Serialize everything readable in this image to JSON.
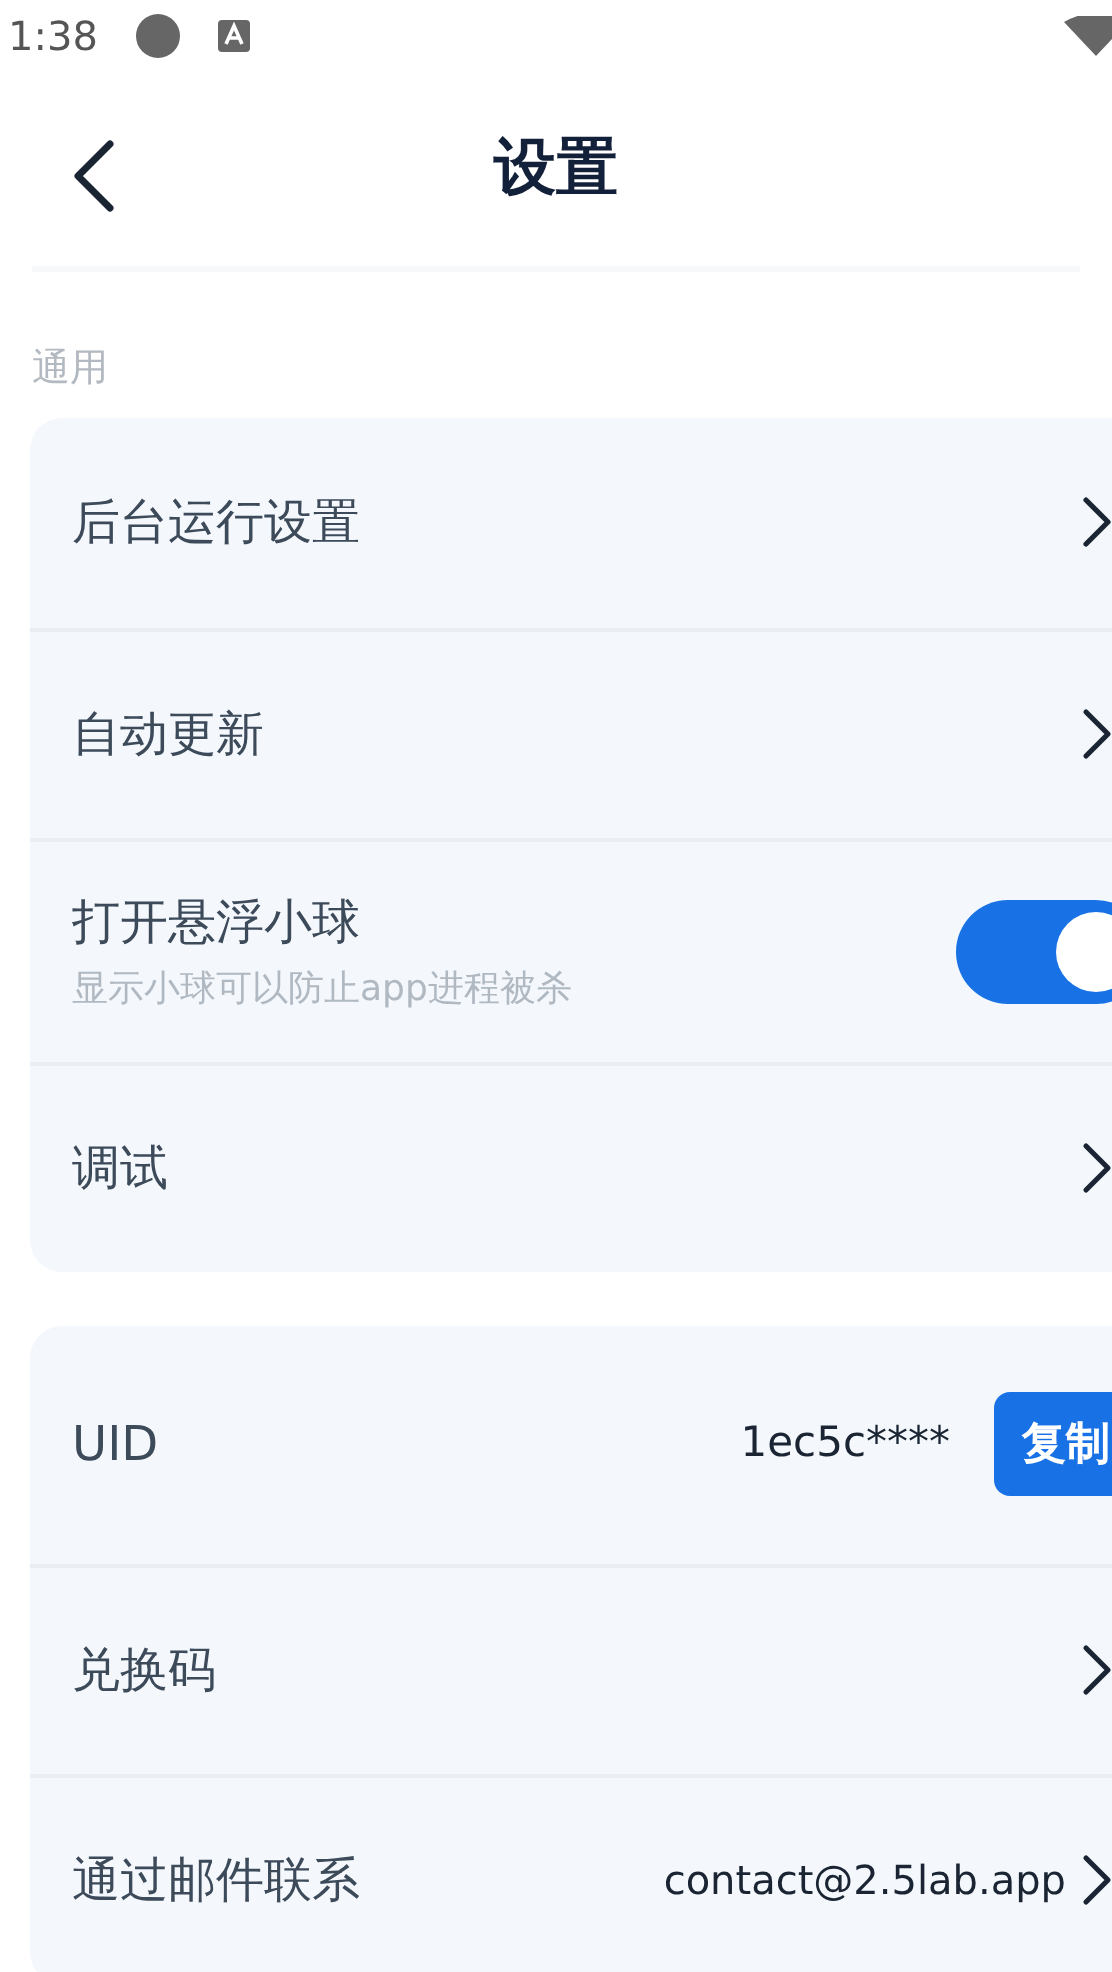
{
  "status_bar": {
    "time": "1:38"
  },
  "header": {
    "title": "设置"
  },
  "sections": [
    {
      "title": "通用",
      "rows": [
        {
          "kind": "link",
          "label": "后台运行设置"
        },
        {
          "kind": "link",
          "label": "自动更新"
        },
        {
          "kind": "toggle",
          "label": "打开悬浮小球",
          "description": "显示小球可以防止app进程被杀",
          "on": true
        },
        {
          "kind": "link",
          "label": "调试"
        }
      ]
    },
    {
      "rows": [
        {
          "kind": "value_button",
          "label": "UID",
          "value": "1ec5c****",
          "button": "复制"
        },
        {
          "kind": "link",
          "label": "兑换码"
        },
        {
          "kind": "value_link",
          "label": "通过邮件联系",
          "value": "contact@2.5lab.app"
        }
      ]
    }
  ]
}
